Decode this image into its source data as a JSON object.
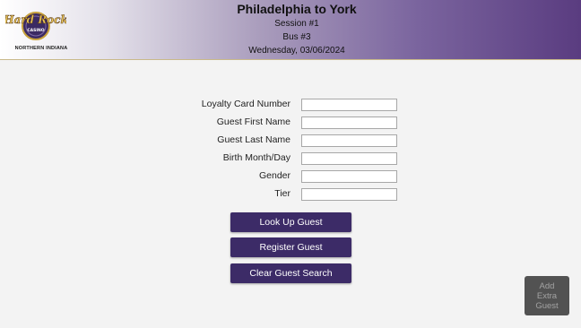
{
  "header": {
    "logo_text": [
      "Hard Rock",
      "CASINO"
    ],
    "logo_subtitle": "NORTHERN INDIANA",
    "title": "Philadelphia to York",
    "session": "Session #1",
    "bus": "Bus #3",
    "date": "Wednesday, 03/06/2024"
  },
  "form": {
    "fields": [
      {
        "label": "Loyalty Card Number",
        "value": ""
      },
      {
        "label": "Guest First Name",
        "value": ""
      },
      {
        "label": "Guest Last Name",
        "value": ""
      },
      {
        "label": "Birth Month/Day",
        "value": ""
      },
      {
        "label": "Gender",
        "value": ""
      },
      {
        "label": "Tier",
        "value": ""
      }
    ]
  },
  "buttons": {
    "lookup": "Look Up Guest",
    "register": "Register Guest",
    "clear": "Clear Guest Search",
    "add_extra": [
      "Add",
      "Extra",
      "Guest"
    ]
  },
  "colors": {
    "button_bg": "#3c2b67",
    "header_gradient_end": "#5a3c80",
    "disabled_button_bg": "#525252"
  }
}
